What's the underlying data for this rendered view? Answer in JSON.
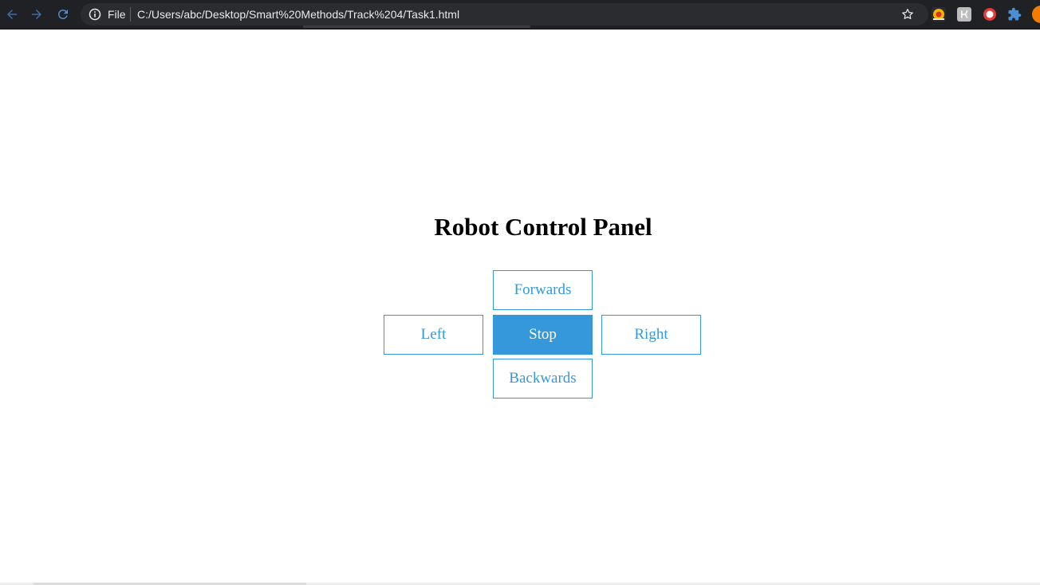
{
  "browser": {
    "scheme_label": "File",
    "url": "C:/Users/abc/Desktop/Smart%20Methods/Track%204/Task1.html",
    "icons": {
      "back": "back-arrow-icon",
      "forward": "forward-arrow-icon",
      "reload": "reload-icon",
      "info": "info-icon",
      "bookmark": "star-icon",
      "extensions": [
        "extension-orange-icon",
        "extension-gray-icon",
        "extension-red-icon",
        "puzzle-extensions-icon"
      ],
      "profile": "profile-avatar-icon"
    }
  },
  "page": {
    "title": "Robot Control Panel",
    "controls": {
      "forwards": "Forwards",
      "left": "Left",
      "stop": "Stop",
      "right": "Right",
      "backwards": "Backwards"
    },
    "active_control": "stop",
    "accent_color": "#3498db"
  }
}
